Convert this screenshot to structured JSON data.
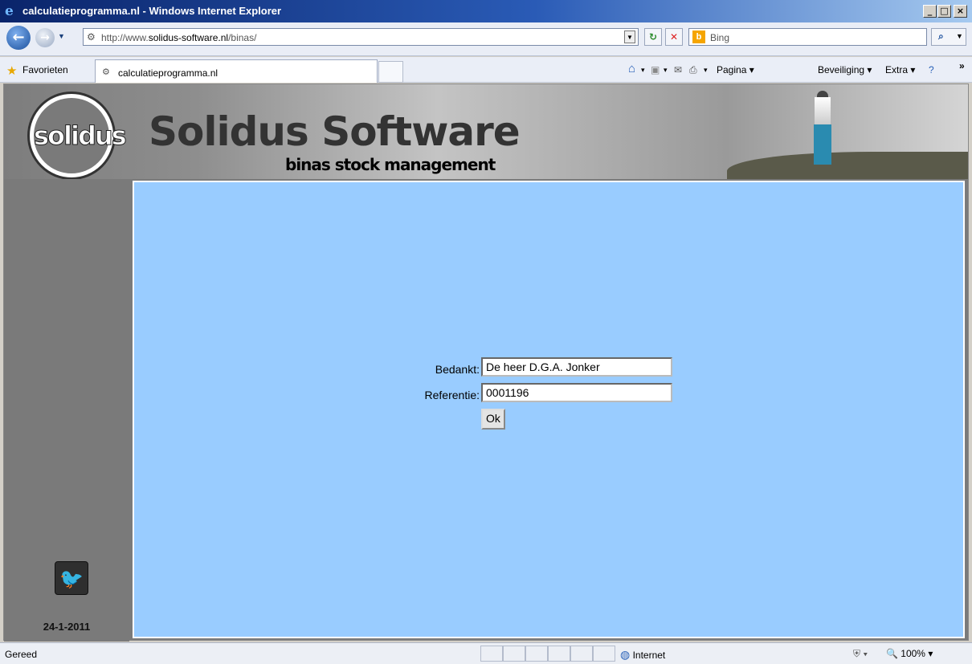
{
  "window": {
    "title": "calculatieprogramma.nl - Windows Internet Explorer",
    "buttons": [
      "_",
      "□",
      "×"
    ]
  },
  "address": {
    "url_prefix": "http://www.",
    "url_domain": "solidus-software.nl",
    "url_path": "/binas/",
    "search_placeholder": "Bing"
  },
  "favbar": {
    "favorites_label": "Favorieten",
    "tab_label": "calculatieprogramma.nl",
    "commands": {
      "page": "Pagina",
      "security": "Beveiliging",
      "extra": "Extra"
    }
  },
  "site": {
    "logo_text": "solidus",
    "brand": "Solidus Software",
    "tagline": "binas stock management",
    "date": "24-1-2011"
  },
  "form": {
    "bedankt_label": "Bedankt:",
    "bedankt_value": "De heer D.G.A. Jonker",
    "referentie_label": "Referentie:",
    "referentie_value": "0001196",
    "ok_label": "Ok"
  },
  "statusbar": {
    "status": "Gereed",
    "zone": "Internet",
    "zoom": "100%"
  }
}
